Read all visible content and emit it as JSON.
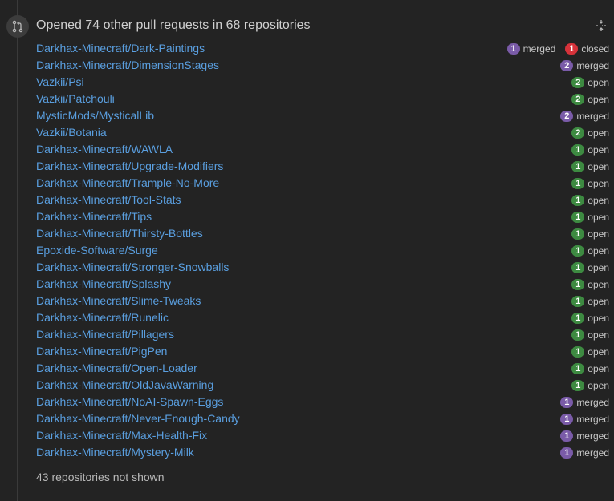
{
  "header": {
    "title": "Opened 74 other pull requests in 68 repositories"
  },
  "repos": [
    {
      "name": "Darkhax-Minecraft/Dark-Paintings",
      "states": [
        {
          "count": "1",
          "type": "merged",
          "label": "merged"
        },
        {
          "count": "1",
          "type": "closed",
          "label": "closed"
        }
      ]
    },
    {
      "name": "Darkhax-Minecraft/DimensionStages",
      "states": [
        {
          "count": "2",
          "type": "merged",
          "label": "merged"
        }
      ]
    },
    {
      "name": "Vazkii/Psi",
      "states": [
        {
          "count": "2",
          "type": "open",
          "label": "open"
        }
      ]
    },
    {
      "name": "Vazkii/Patchouli",
      "states": [
        {
          "count": "2",
          "type": "open",
          "label": "open"
        }
      ]
    },
    {
      "name": "MysticMods/MysticalLib",
      "states": [
        {
          "count": "2",
          "type": "merged",
          "label": "merged"
        }
      ]
    },
    {
      "name": "Vazkii/Botania",
      "states": [
        {
          "count": "2",
          "type": "open",
          "label": "open"
        }
      ]
    },
    {
      "name": "Darkhax-Minecraft/WAWLA",
      "states": [
        {
          "count": "1",
          "type": "open",
          "label": "open"
        }
      ]
    },
    {
      "name": "Darkhax-Minecraft/Upgrade-Modifiers",
      "states": [
        {
          "count": "1",
          "type": "open",
          "label": "open"
        }
      ]
    },
    {
      "name": "Darkhax-Minecraft/Trample-No-More",
      "states": [
        {
          "count": "1",
          "type": "open",
          "label": "open"
        }
      ]
    },
    {
      "name": "Darkhax-Minecraft/Tool-Stats",
      "states": [
        {
          "count": "1",
          "type": "open",
          "label": "open"
        }
      ]
    },
    {
      "name": "Darkhax-Minecraft/Tips",
      "states": [
        {
          "count": "1",
          "type": "open",
          "label": "open"
        }
      ]
    },
    {
      "name": "Darkhax-Minecraft/Thirsty-Bottles",
      "states": [
        {
          "count": "1",
          "type": "open",
          "label": "open"
        }
      ]
    },
    {
      "name": "Epoxide-Software/Surge",
      "states": [
        {
          "count": "1",
          "type": "open",
          "label": "open"
        }
      ]
    },
    {
      "name": "Darkhax-Minecraft/Stronger-Snowballs",
      "states": [
        {
          "count": "1",
          "type": "open",
          "label": "open"
        }
      ]
    },
    {
      "name": "Darkhax-Minecraft/Splashy",
      "states": [
        {
          "count": "1",
          "type": "open",
          "label": "open"
        }
      ]
    },
    {
      "name": "Darkhax-Minecraft/Slime-Tweaks",
      "states": [
        {
          "count": "1",
          "type": "open",
          "label": "open"
        }
      ]
    },
    {
      "name": "Darkhax-Minecraft/Runelic",
      "states": [
        {
          "count": "1",
          "type": "open",
          "label": "open"
        }
      ]
    },
    {
      "name": "Darkhax-Minecraft/Pillagers",
      "states": [
        {
          "count": "1",
          "type": "open",
          "label": "open"
        }
      ]
    },
    {
      "name": "Darkhax-Minecraft/PigPen",
      "states": [
        {
          "count": "1",
          "type": "open",
          "label": "open"
        }
      ]
    },
    {
      "name": "Darkhax-Minecraft/Open-Loader",
      "states": [
        {
          "count": "1",
          "type": "open",
          "label": "open"
        }
      ]
    },
    {
      "name": "Darkhax-Minecraft/OldJavaWarning",
      "states": [
        {
          "count": "1",
          "type": "open",
          "label": "open"
        }
      ]
    },
    {
      "name": "Darkhax-Minecraft/NoAI-Spawn-Eggs",
      "states": [
        {
          "count": "1",
          "type": "merged",
          "label": "merged"
        }
      ]
    },
    {
      "name": "Darkhax-Minecraft/Never-Enough-Candy",
      "states": [
        {
          "count": "1",
          "type": "merged",
          "label": "merged"
        }
      ]
    },
    {
      "name": "Darkhax-Minecraft/Max-Health-Fix",
      "states": [
        {
          "count": "1",
          "type": "merged",
          "label": "merged"
        }
      ]
    },
    {
      "name": "Darkhax-Minecraft/Mystery-Milk",
      "states": [
        {
          "count": "1",
          "type": "merged",
          "label": "merged"
        }
      ]
    }
  ],
  "footer": {
    "note": "43 repositories not shown"
  },
  "icons": {
    "timeline": "git-pull-request-icon",
    "collapse": "unfold-icon"
  },
  "colors": {
    "background": "#232323",
    "link": "#5a9fe0",
    "merged": "#7a5ba8",
    "open": "#3d8a41",
    "closed": "#d6323a"
  }
}
